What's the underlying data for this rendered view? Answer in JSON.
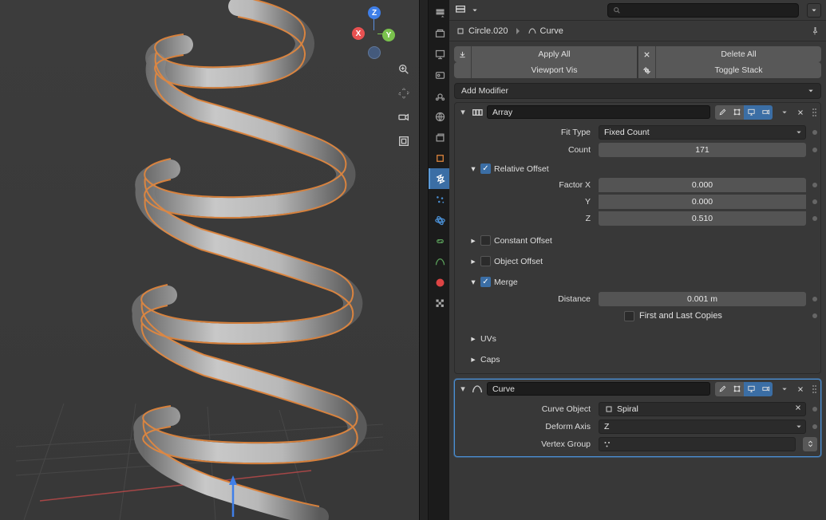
{
  "breadcrumb": {
    "object_name": "Circle.020",
    "data_name": "Curve"
  },
  "search": {
    "placeholder": ""
  },
  "buttons": {
    "apply_all": "Apply All",
    "delete_all": "Delete All",
    "viewport_vis": "Viewport Vis",
    "toggle_stack": "Toggle Stack",
    "add_modifier": "Add Modifier"
  },
  "modifiers": {
    "array": {
      "name": "Array",
      "fit_type_label": "Fit Type",
      "fit_type": "Fixed Count",
      "count_label": "Count",
      "count": "171",
      "relative_offset_label": "Relative Offset",
      "factor_x_label": "Factor X",
      "factor_x": "0.000",
      "y_label": "Y",
      "factor_y": "0.000",
      "z_label": "Z",
      "factor_z": "0.510",
      "constant_offset_label": "Constant Offset",
      "object_offset_label": "Object Offset",
      "merge_label": "Merge",
      "distance_label": "Distance",
      "distance": "0.001 m",
      "first_last_label": "First and Last Copies",
      "uvs_label": "UVs",
      "caps_label": "Caps"
    },
    "curve": {
      "name": "Curve",
      "curve_object_label": "Curve Object",
      "curve_object": "Spiral",
      "deform_axis_label": "Deform Axis",
      "deform_axis": "Z",
      "vertex_group_label": "Vertex Group"
    }
  }
}
